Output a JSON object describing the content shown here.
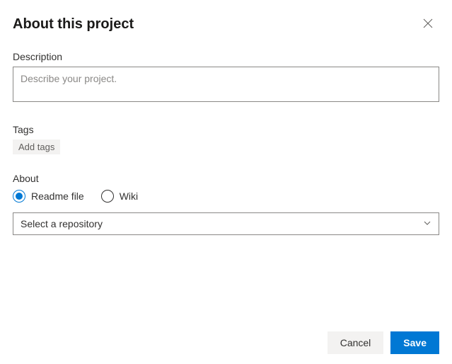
{
  "header": {
    "title": "About this project"
  },
  "description": {
    "label": "Description",
    "placeholder": "Describe your project.",
    "value": ""
  },
  "tags": {
    "label": "Tags",
    "add_label": "Add tags"
  },
  "about": {
    "label": "About",
    "options": {
      "readme": "Readme file",
      "wiki": "Wiki"
    },
    "selected": "readme",
    "repo_select_placeholder": "Select a repository"
  },
  "footer": {
    "cancel": "Cancel",
    "save": "Save"
  }
}
